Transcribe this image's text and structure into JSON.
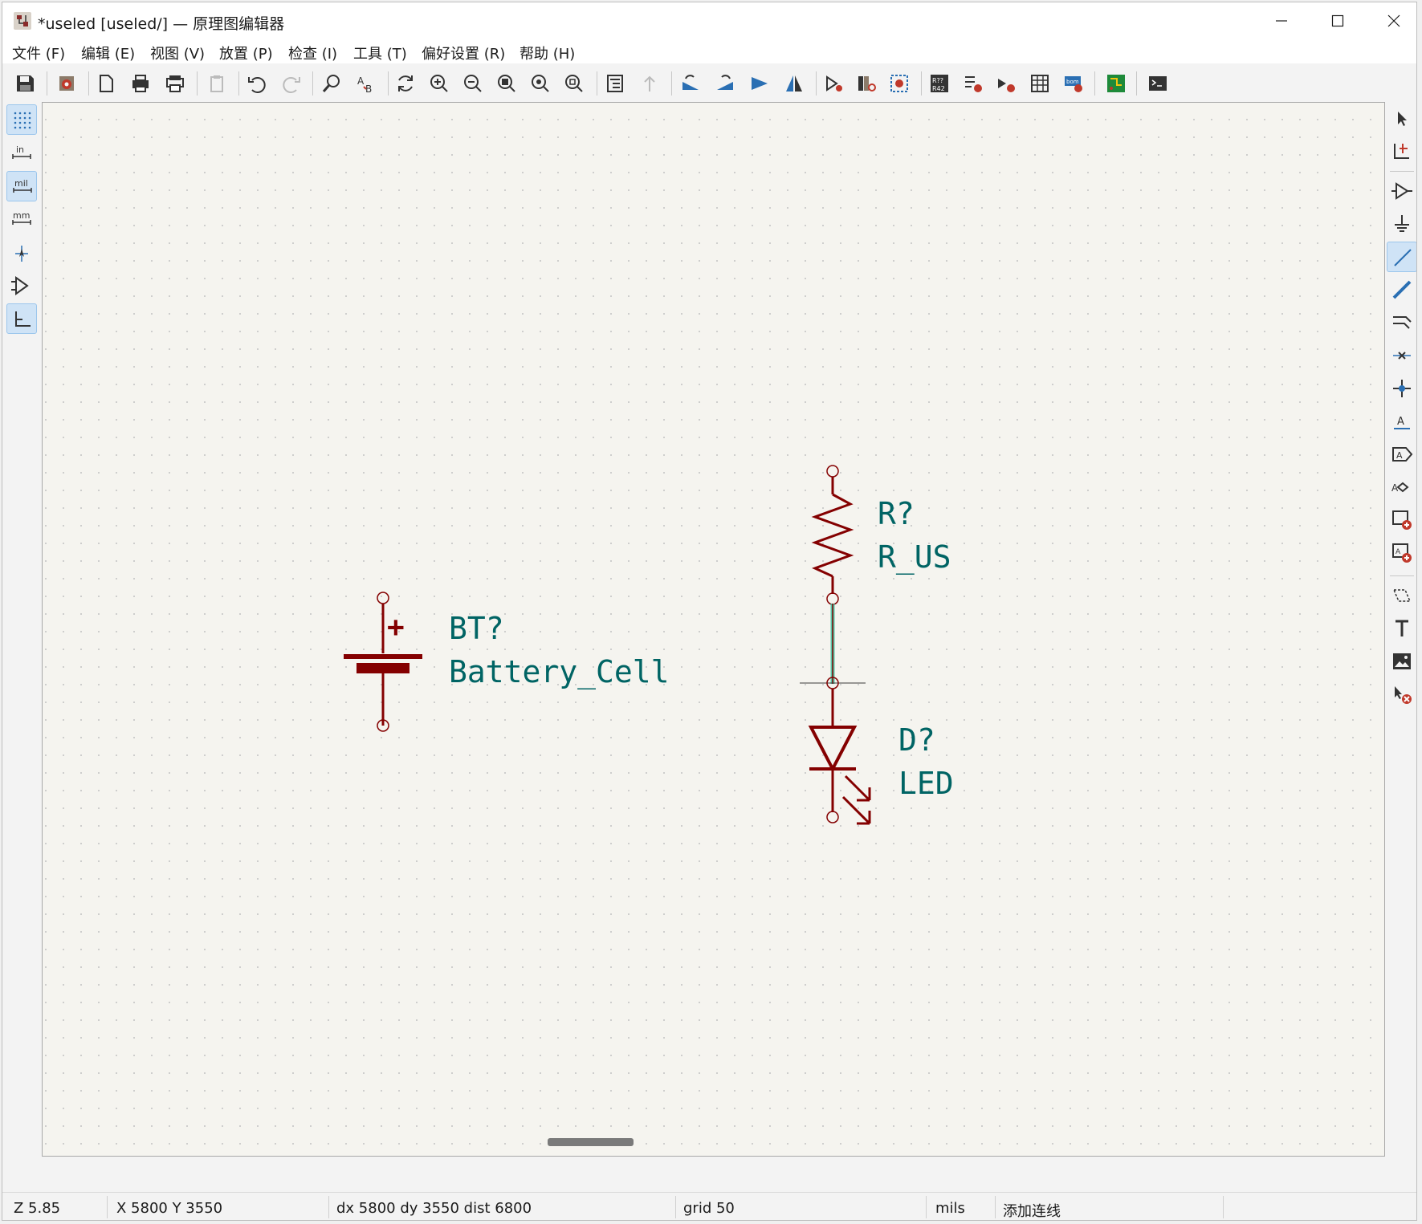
{
  "window": {
    "title": "*useled [useled/] — 原理图编辑器"
  },
  "menu": {
    "items": [
      "文件 (F)",
      "编辑 (E)",
      "视图 (V)",
      "放置 (P)",
      "检查 (I)",
      "工具 (T)",
      "偏好设置 (R)",
      "帮助 (H)"
    ]
  },
  "left_toolbar": {
    "units": {
      "in": "in",
      "mil": "mil",
      "mm": "mm"
    }
  },
  "schematic": {
    "components": [
      {
        "reference": "R?",
        "value": "R_US"
      },
      {
        "reference": "BT?",
        "value": "Battery_Cell",
        "polarity": "+"
      },
      {
        "reference": "D?",
        "value": "LED"
      }
    ],
    "colors": {
      "symbol": "#840000",
      "field_text": "#006464",
      "wire": "#3fbf9f",
      "grid_dots": "#c2c2c2",
      "background": "#f5f4ef"
    }
  },
  "status": {
    "zoom": "Z 5.85",
    "cursor": "X 5800  Y 3550",
    "delta": "dx 5800  dy 3550  dist 6800",
    "grid": "grid 50",
    "units": "mils",
    "mode": "添加连线"
  }
}
